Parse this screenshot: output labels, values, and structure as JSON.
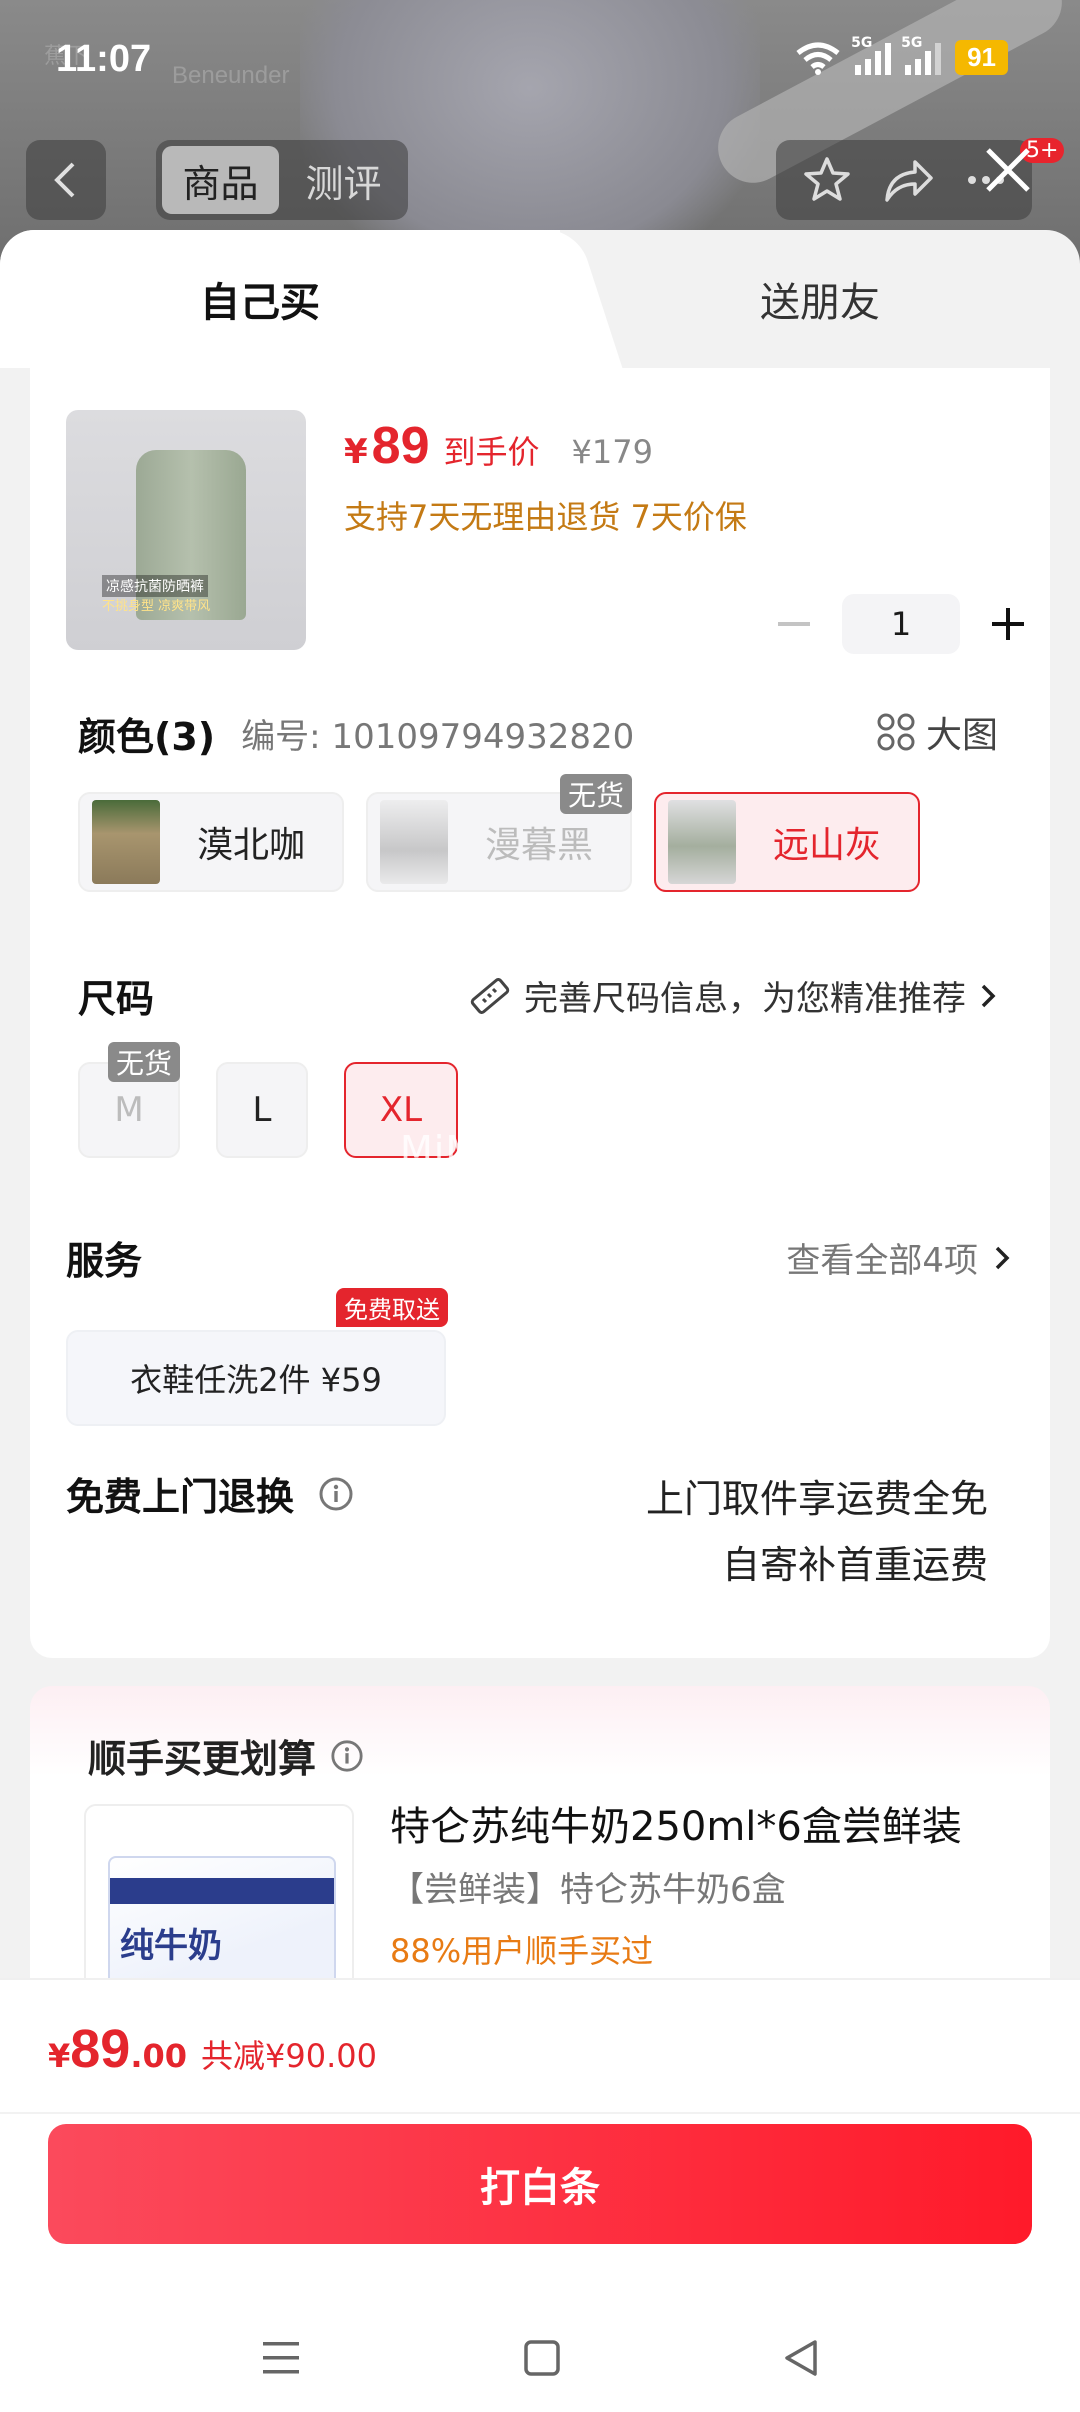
{
  "status_bar": {
    "time": "11:07",
    "signal1": "5G",
    "signal2": "5G",
    "battery": "91"
  },
  "background": {
    "brand_cn": "蕉下",
    "brand_en": "Beneunder"
  },
  "top_nav": {
    "tabs": [
      "商品",
      "测评"
    ],
    "cart_badge": "5+"
  },
  "sheet_tabs": {
    "self": "自己买",
    "gift": "送朋友"
  },
  "product": {
    "thumb_text1": "凉感抗菌防晒裤",
    "thumb_text2": "不挑身型 凉爽带风",
    "currency": "¥",
    "price": "89",
    "price_tag": "到手价",
    "original_price": "¥179",
    "promise": "支持7天无理由退货  7天价保",
    "quantity": "1"
  },
  "color": {
    "title": "颜色(3)",
    "sku": "编号: 10109794932820",
    "big_pic": "大图",
    "options": [
      {
        "label": "漠北咖",
        "state": "normal",
        "swatch": "#8b7a5a"
      },
      {
        "label": "漫暮黑",
        "state": "disabled",
        "swatch": "#8f8f8f",
        "badge": "无货"
      },
      {
        "label": "远山灰",
        "state": "selected",
        "swatch": "#a4ae9e"
      }
    ]
  },
  "size": {
    "title": "尺码",
    "tip": "完善尺码信息，为您精准推荐",
    "options": [
      {
        "label": "M",
        "state": "disabled",
        "badge": "无货"
      },
      {
        "label": "L",
        "state": "normal"
      },
      {
        "label": "XL",
        "state": "selected"
      }
    ]
  },
  "watermark": "MiMiHDSA",
  "service": {
    "title": "服务",
    "view_all": "查看全部4项",
    "item": "衣鞋任洗2件  ¥59",
    "badge": "免费取送"
  },
  "return": {
    "title": "免费上门退换",
    "line1": "上门取件享运费全免",
    "line2": "自寄补首重运费"
  },
  "recommend": {
    "title": "顺手买更划算",
    "box_text": "纯牛奶",
    "name": "特仑苏纯牛奶250ml*6盒尝鲜装",
    "sub": "【尝鲜装】特仑苏牛奶6盒",
    "stat": "88%用户顺手买过"
  },
  "bottom": {
    "currency": "¥",
    "total_int": "89",
    "total_dec": ".00",
    "save": "共减¥90.00",
    "buy_label": "打白条"
  },
  "colors": {
    "accent": "#e4252d",
    "promise": "#c47a14",
    "stat": "#e87b14"
  }
}
